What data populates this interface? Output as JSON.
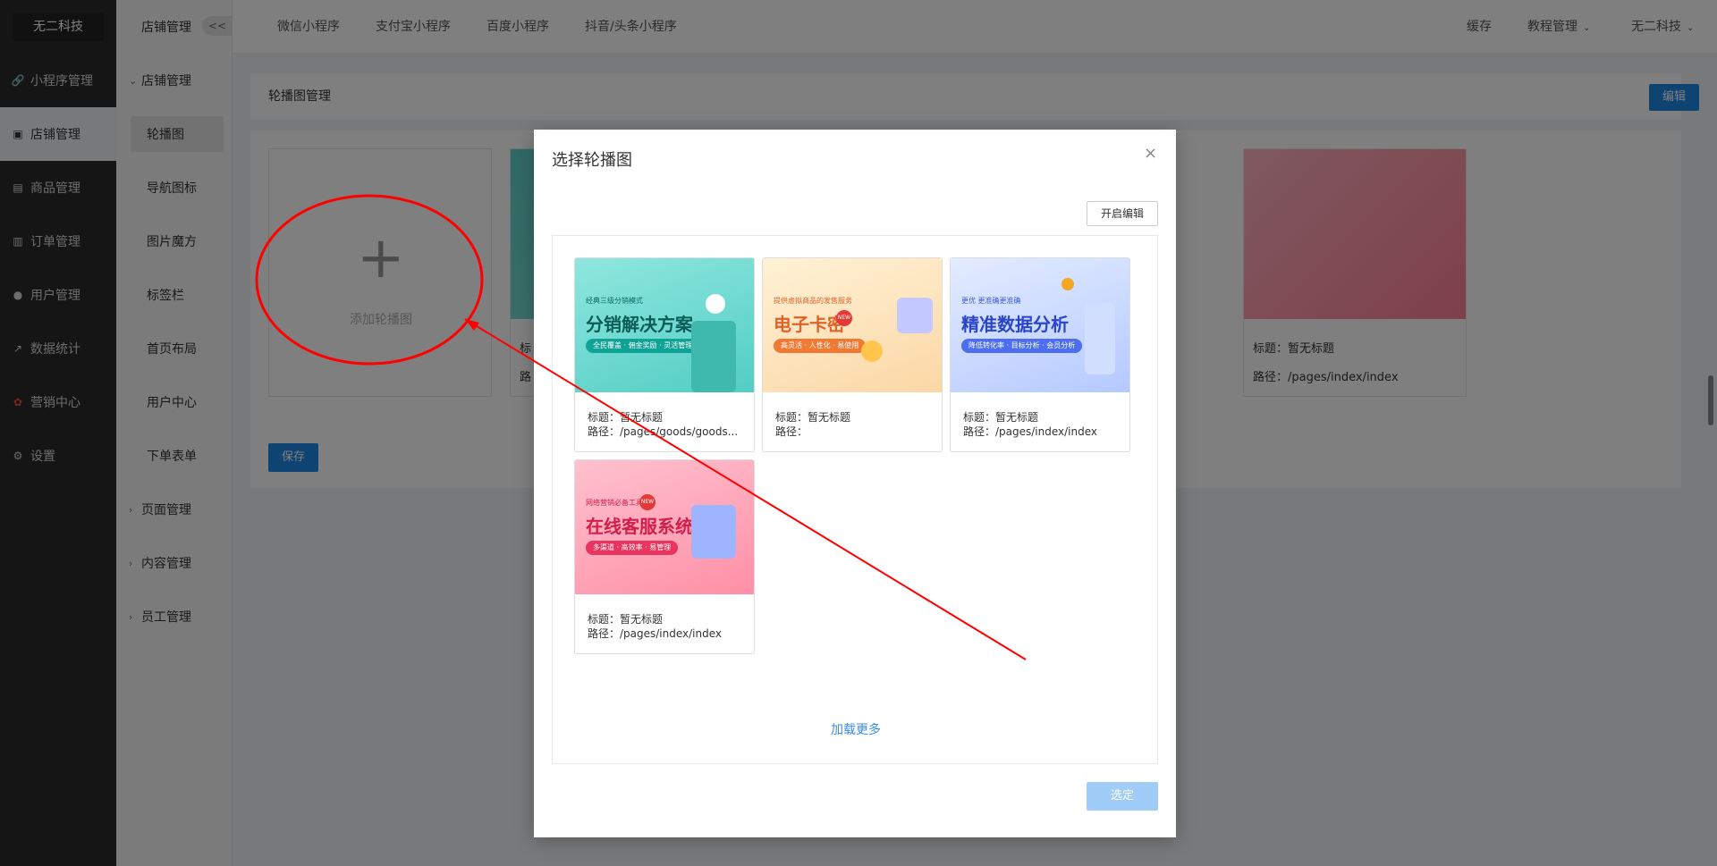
{
  "sidebar": {
    "brand": "无二科技",
    "items": [
      {
        "label": "小程序管理",
        "icon": "link-icon"
      },
      {
        "label": "店铺管理",
        "icon": "store-icon"
      },
      {
        "label": "商品管理",
        "icon": "box-icon"
      },
      {
        "label": "订单管理",
        "icon": "order-icon"
      },
      {
        "label": "用户管理",
        "icon": "user-icon"
      },
      {
        "label": "数据统计",
        "icon": "chart-icon"
      },
      {
        "label": "营销中心",
        "icon": "marketing-icon"
      },
      {
        "label": "设置",
        "icon": "gear-icon"
      }
    ]
  },
  "subsidebar": {
    "title": "店铺管理",
    "collapse": "<<",
    "group": "店铺管理",
    "items": [
      "轮播图",
      "导航图标",
      "图片魔方",
      "标签栏",
      "首页布局",
      "用户中心",
      "下单表单"
    ],
    "groups": [
      "页面管理",
      "内容管理",
      "员工管理"
    ]
  },
  "topnav": {
    "tabs": [
      "微信小程序",
      "支付宝小程序",
      "百度小程序",
      "抖音/头条小程序"
    ],
    "cache": "缓存",
    "tutorial": "教程管理",
    "account": "无二科技"
  },
  "page": {
    "title": "轮播图管理",
    "edit": "编辑",
    "add_label": "添加轮播图",
    "save": "保存",
    "bg_cards": [
      {
        "title": "标题：暂无标题",
        "path": "路径：/pages/index/index"
      }
    ],
    "bg_partial_title": "标",
    "bg_partial_path": "路"
  },
  "modal": {
    "title": "选择轮播图",
    "close": "×",
    "edit_toggle": "开启编辑",
    "cards": [
      {
        "title": "标题：暂无标题",
        "path": "路径：/pages/goods/goods...",
        "kicker": "经典三级分销模式",
        "headline": "分销解决方案",
        "pill": "全民覆盖 · 佣金奖励 · 灵活管理"
      },
      {
        "title": "标题：暂无标题",
        "path": "路径：",
        "kicker": "提供虚拟商品的发售服务",
        "headline": "电子卡密",
        "pill": "高灵活 · 人性化 · 易使用"
      },
      {
        "title": "标题：暂无标题",
        "path": "路径：/pages/index/index",
        "kicker": "更优 更准确更准确",
        "headline": "精准数据分析",
        "pill": "降低转化率 · 目标分析 · 会员分析"
      },
      {
        "title": "标题：暂无标题",
        "path": "路径：/pages/index/index",
        "kicker": "网络营销必备工具",
        "headline": "在线客服系统",
        "pill": "多渠道 · 高效率 · 易管理"
      }
    ],
    "new_badge": "NEW",
    "load_more": "加载更多",
    "confirm": "选定"
  },
  "colors": {
    "accent": "#1e88e5",
    "sidebar": "#2b2b2b",
    "annotation": "#ff0000"
  }
}
